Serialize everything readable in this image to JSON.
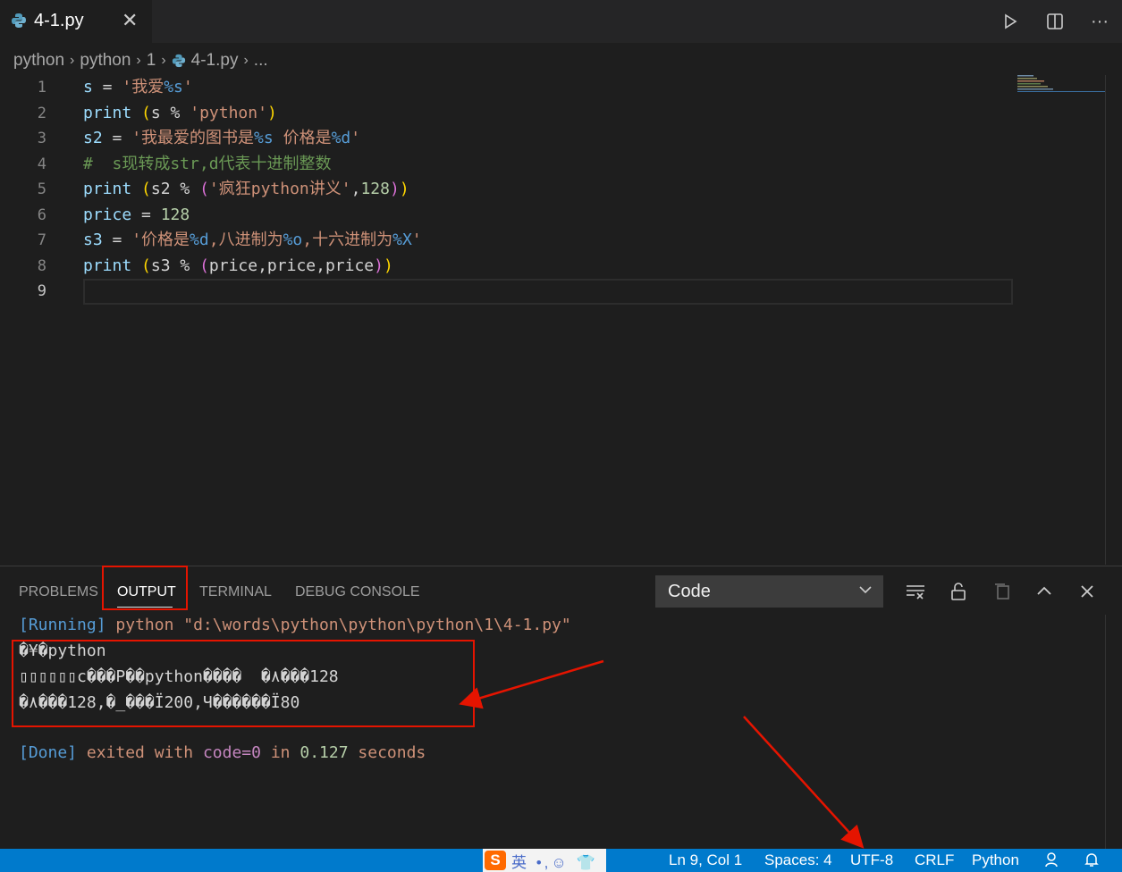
{
  "tab": {
    "file_name": "4-1.py",
    "close_glyph": "✕"
  },
  "title_actions": {
    "run_icon": "play-icon",
    "split_icon": "split-editor-icon",
    "more_glyph": "···"
  },
  "breadcrumb": [
    "python",
    "python",
    "1",
    "4-1.py",
    "..."
  ],
  "breadcrumb_sep": "›",
  "line_numbers": [
    "1",
    "2",
    "3",
    "4",
    "5",
    "6",
    "7",
    "8",
    "9"
  ],
  "code_lines": [
    [
      [
        "v",
        "s"
      ],
      [
        "o",
        " = "
      ],
      [
        "s",
        "'我爱"
      ],
      [
        "sp",
        "%s"
      ],
      [
        "s",
        "'"
      ]
    ],
    [
      [
        "f",
        "print"
      ],
      [
        "o",
        " "
      ],
      [
        "pr",
        "("
      ],
      [
        "o",
        "s % "
      ],
      [
        "s",
        "'python'"
      ],
      [
        "pr",
        ")"
      ]
    ],
    [
      [
        "v",
        "s2"
      ],
      [
        "o",
        " = "
      ],
      [
        "s",
        "'我最爱的图书是"
      ],
      [
        "sp",
        "%s"
      ],
      [
        "s",
        " 价格是"
      ],
      [
        "sp",
        "%d"
      ],
      [
        "s",
        "'"
      ]
    ],
    [
      [
        "c",
        "#  s现转成str,d代表十进制整数"
      ]
    ],
    [
      [
        "f",
        "print"
      ],
      [
        "o",
        " "
      ],
      [
        "pr",
        "("
      ],
      [
        "o",
        "s2 % "
      ],
      [
        "p2",
        "("
      ],
      [
        "s",
        "'疯狂python讲义'"
      ],
      [
        "o",
        ","
      ],
      [
        "n",
        "128"
      ],
      [
        "p2",
        ")"
      ],
      [
        "pr",
        ")"
      ]
    ],
    [
      [
        "v",
        "price"
      ],
      [
        "o",
        " = "
      ],
      [
        "n",
        "128"
      ]
    ],
    [
      [
        "v",
        "s3"
      ],
      [
        "o",
        " = "
      ],
      [
        "s",
        "'价格是"
      ],
      [
        "sp",
        "%d"
      ],
      [
        "s",
        ",八进制为"
      ],
      [
        "sp",
        "%o"
      ],
      [
        "s",
        ",十六进制为"
      ],
      [
        "sp",
        "%X"
      ],
      [
        "s",
        "'"
      ]
    ],
    [
      [
        "f",
        "print"
      ],
      [
        "o",
        " "
      ],
      [
        "pr",
        "("
      ],
      [
        "o",
        "s3 % "
      ],
      [
        "p2",
        "("
      ],
      [
        "o",
        "price,price,price"
      ],
      [
        "p2",
        ")"
      ],
      [
        "pr",
        ")"
      ]
    ],
    []
  ],
  "panel": {
    "tabs": [
      "PROBLEMS",
      "OUTPUT",
      "TERMINAL",
      "DEBUG CONSOLE"
    ],
    "active_tab": "OUTPUT",
    "channel": "Code",
    "running_tag": "[Running]",
    "running_cmd": "python \"d:\\words\\python\\python\\python\\1\\4-1.py\"",
    "output_lines": [
      "�¥�python",
      "▯▯▯▯▯▯c���P��python����  �٨���128",
      "�٨���128,�_���Ï200,Ч������Ï80"
    ],
    "done_tag": "[Done]",
    "done_exited": "exited",
    "done_with": "with",
    "done_code": "code=0",
    "done_in": "in",
    "done_time": "0.127",
    "done_seconds": "seconds"
  },
  "ime": {
    "logo": "S",
    "text": "英 •,☺ 👕"
  },
  "statusbar": {
    "position": "Ln 9, Col 1",
    "spaces": "Spaces: 4",
    "encoding": "UTF-8",
    "eol": "CRLF",
    "language": "Python"
  },
  "colors": {
    "accent": "#007acc",
    "annotation": "#e51400"
  }
}
